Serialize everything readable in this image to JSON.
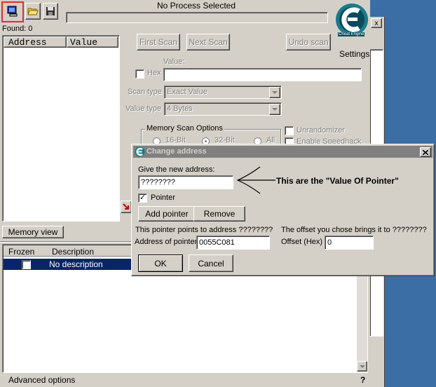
{
  "process_title": "No Process Selected",
  "found": "Found: 0",
  "results_columns": [
    "Address",
    "Value"
  ],
  "buttons": {
    "first_scan": "First Scan",
    "next_scan": "Next Scan",
    "undo_scan": "Undo scan",
    "memory_view": "Memory view",
    "add_pointer": "Add pointer",
    "remove": "Remove",
    "ok": "OK",
    "cancel": "Cancel"
  },
  "settings_label": "Settings",
  "logo_text": "Cheat Engine",
  "scan": {
    "value_label": "Value:",
    "hex_label": "Hex",
    "scan_type_label": "Scan type",
    "scan_type_value": "Exact Value",
    "value_type_label": "Value type",
    "value_type_value": "4 Bytes",
    "memory_scan_options": "Memory Scan Options",
    "bit16": "16-Bit",
    "bit32": "32-Bit",
    "all": "All",
    "unrandomizer": "Unrandomizer",
    "enable_speedhack": "Enable Speedhack"
  },
  "address_list": {
    "col_frozen": "Frozen",
    "col_description": "Description",
    "row_description": "No description"
  },
  "advanced_options": "Advanced options",
  "help_mark": "?",
  "dialog": {
    "title": "Change address",
    "give_new_address": "Give the new address:",
    "address_value": "????????",
    "pointer_label": "Pointer",
    "points_to": "This pointer points to address ????????",
    "offset_brings": "The offset you chose brings it to ????????",
    "address_of_pointer_label": "Address of pointer",
    "address_of_pointer_value": "0055C081",
    "offset_label": "Offset (Hex)",
    "offset_value": "0",
    "close_glyph": "X"
  },
  "annotation": "This are the \"Value Of Pointer\"",
  "colors": {
    "desktop": "#3a6ea5",
    "face": "#d4d0c8",
    "selection": "#0a246a",
    "title_active": "#808080"
  }
}
